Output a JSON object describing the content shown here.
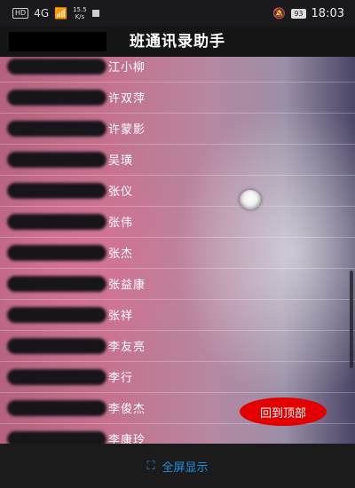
{
  "status_bar": {
    "network": "HD",
    "signal": "4G",
    "speed_value": "15.5",
    "speed_unit": "K/s",
    "battery": "93",
    "time": "18:03"
  },
  "header": {
    "title": "班通讯录助手"
  },
  "list": {
    "items": [
      {
        "name": "江小柳"
      },
      {
        "name": "许双萍"
      },
      {
        "name": "许蒙影"
      },
      {
        "name": "吴璜"
      },
      {
        "name": "张仪"
      },
      {
        "name": "张伟"
      },
      {
        "name": "张杰"
      },
      {
        "name": "张益康"
      },
      {
        "name": "张祥"
      },
      {
        "name": "李友亮"
      },
      {
        "name": "李行"
      },
      {
        "name": "李俊杰"
      },
      {
        "name": "李康玲"
      }
    ]
  },
  "floating": {
    "back_to_top": "回到顶部"
  },
  "bottom": {
    "fullscreen_label": "全屏显示"
  },
  "colors": {
    "accent_red": "#e20000",
    "link_blue": "#1e8fe0"
  }
}
